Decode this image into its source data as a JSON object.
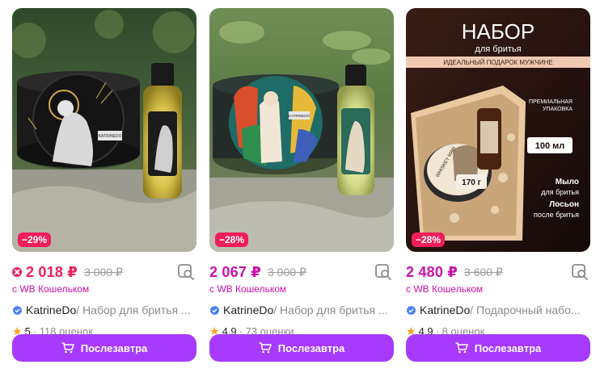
{
  "products": [
    {
      "discount": "−29%",
      "price": "2 018 ₽",
      "old_price": "3 000 ₽",
      "wallet": "с WB Кошельком",
      "brand": "KatrineDo",
      "name": " / Набор для бритья ...",
      "rating": "5",
      "reviews": "· 118 оценок",
      "button": "Послезавтра",
      "image_text": "KATRINEDO"
    },
    {
      "discount": "−28%",
      "price": "2 067 ₽",
      "old_price": "3 000 ₽",
      "wallet": "с WB Кошельком",
      "brand": "KatrineDo",
      "name": " / Набор для бритья ...",
      "rating": "4,9",
      "reviews": "· 73 оценки",
      "button": "Послезавтра",
      "image_text": "KATRINEDO"
    },
    {
      "discount": "−28%",
      "price": "2 480 ₽",
      "old_price": "3 600 ₽",
      "wallet": "с WB Кошельком",
      "brand": "KatrineDo",
      "name": " / Подарочный набо...",
      "rating": "4,9",
      "reviews": "· 8 оценок",
      "button": "Послезавтра",
      "promo": {
        "title": "НАБОР",
        "subtitle": "для бритья",
        "banner": "ИДЕАЛЬНЫЙ ПОДАРОК МУЖЧИНЕ",
        "packaging": "ПРЕМИАЛЬНАЯ\nУПАКОВКА",
        "volume": "100 мл",
        "weight": "170 г",
        "soap": "Мыло",
        "soap_sub": "для бритья",
        "lotion": "Лосьон",
        "lotion_sub": "после бритья",
        "can_text": "WHISKEY MAN"
      }
    }
  ],
  "colors": {
    "accent": "#cb11ab",
    "sale_red": "#f01e5a",
    "button": "#a73afd",
    "star": "#ff9f1a",
    "muted": "#8b8b8b"
  }
}
